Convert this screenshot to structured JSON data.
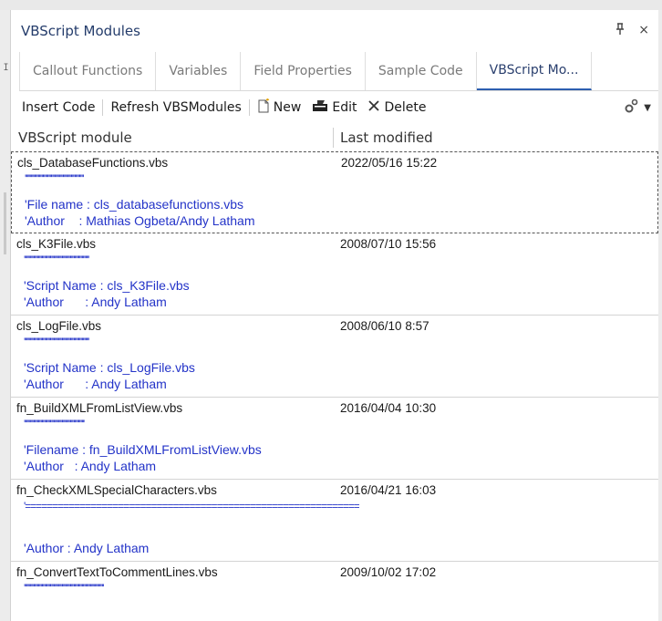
{
  "window": {
    "title": "VBScript Modules",
    "pin_glyph": "ᚡ",
    "close_glyph": "×"
  },
  "tabs": [
    {
      "label": "Callout Functions",
      "active": false
    },
    {
      "label": "Variables",
      "active": false
    },
    {
      "label": "Field Properties",
      "active": false
    },
    {
      "label": "Sample Code",
      "active": false
    },
    {
      "label": "VBScript Mo...",
      "active": true
    }
  ],
  "toolbar": {
    "insert_code": "Insert Code",
    "refresh": "Refresh VBSModules",
    "new": "New",
    "edit": "Edit",
    "delete": "Delete"
  },
  "columns": {
    "module": "VBScript module",
    "modified": "Last modified"
  },
  "rows": [
    {
      "name": "cls_DatabaseFunctions.vbs",
      "date": "2022/05/16 15:22",
      "line1": "''''''''''''''''''''''''''''''''''''''''''''''''''",
      "line2": "'File name : cls_databasefunctions.vbs",
      "line3": "'Author    : Mathias Ogbeta/Andy Latham",
      "selected": true
    },
    {
      "name": "cls_K3File.vbs",
      "date": "2008/07/10 15:56",
      "line1": "''''''''''''''''''''''''''''''''''''''''''''''''''''''''",
      "line2": "'Script Name : cls_K3File.vbs",
      "line3": "'Author      : Andy Latham",
      "selected": false
    },
    {
      "name": "cls_LogFile.vbs",
      "date": "2008/06/10  8:57",
      "line1": "''''''''''''''''''''''''''''''''''''''''''''''''''''''''",
      "line2": "'Script Name : cls_LogFile.vbs",
      "line3": "'Author      : Andy Latham",
      "selected": false
    },
    {
      "name": "fn_BuildXMLFromListView.vbs",
      "date": "2016/04/04 10:30",
      "line1": "''''''''''''''''''''''''''''''''''''''''''''''''''''",
      "line2": "'Filename : fn_BuildXMLFromListView.vbs",
      "line3": "'Author   : Andy Latham",
      "selected": false
    },
    {
      "name": "fn_CheckXMLSpecialCharacters.vbs",
      "date": "2016/04/21 16:03",
      "line1": "'=============================================================",
      "line2": "",
      "line3": "'Author : Andy Latham",
      "selected": false
    },
    {
      "name": "fn_ConvertTextToCommentLines.vbs",
      "date": "2009/10/02 17:02",
      "line1": "''''''''''''''''''''''''''''''''''''''''''''''''''''''''''''''''''''",
      "line2": "",
      "line3": "",
      "selected": false
    }
  ],
  "colors": {
    "comment_blue": "#2333c8",
    "title_navy": "#243c6b",
    "active_tab_underline": "#2d5fb0"
  }
}
